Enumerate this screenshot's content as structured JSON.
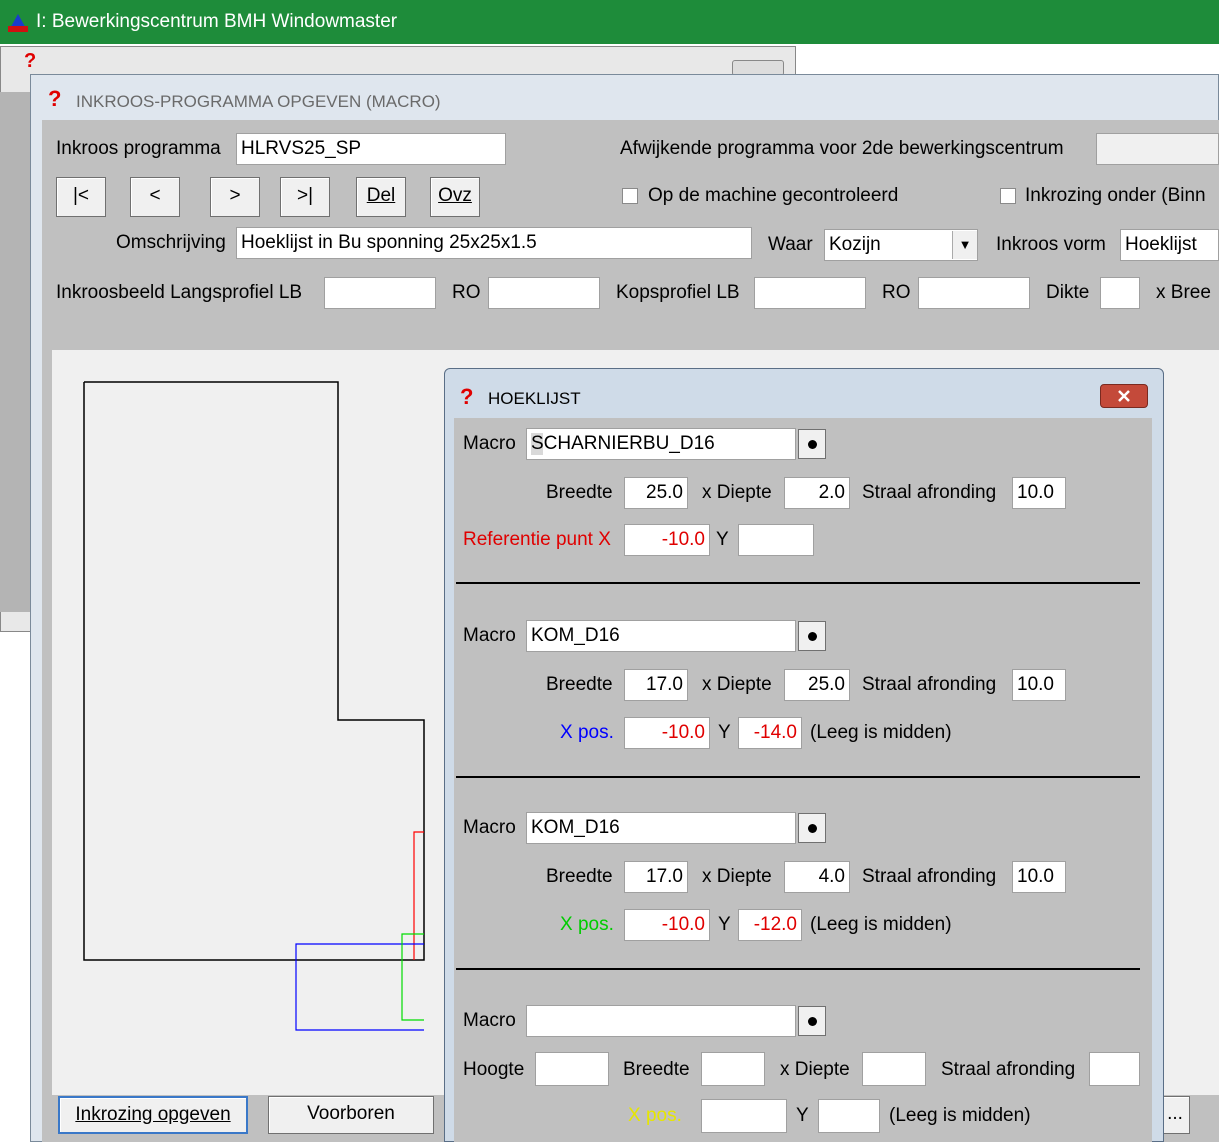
{
  "app": {
    "title": "I: Bewerkingscentrum BMH Windowmaster"
  },
  "main": {
    "title": "INKROOS-PROGRAMMA OPGEVEN (MACRO)",
    "inkroos_programma_label": "Inkroos programma",
    "inkroos_programma_value": "HLRVS25_SP",
    "afwijkend_label": "Afwijkende programma voor 2de bewerkingscentrum",
    "afwijkend_value": "",
    "nav": {
      "first": "|<",
      "prev": "<",
      "next": ">",
      "last": ">|",
      "del": "Del",
      "ovz": "Ovz"
    },
    "checkbox_gecontroleerd": "Op de machine gecontroleerd",
    "checkbox_onder": "Inkrozing onder (Binn",
    "omschrijving_label": "Omschrijving",
    "omschrijving_value": "Hoeklijst in Bu sponning 25x25x1.5",
    "waar_label": "Waar",
    "waar_value": "Kozijn",
    "vorm_label": "Inkroos vorm",
    "vorm_value": "Hoeklijst",
    "langs_label": "Inkroosbeeld Langsprofiel LB",
    "ro_label": "RO",
    "kops_label": "Kopsprofiel LB",
    "ro2_label": "RO",
    "dikte_label": "Dikte",
    "breedte_label": "x Bree",
    "btn_inkrozing": "Inkrozing opgeven",
    "btn_voorboren": "Voorboren",
    "btn_more": "..."
  },
  "dialog": {
    "title": "HOEKLIJST",
    "macro_label": "Macro",
    "sections": [
      {
        "macro": "SCHARNIERBU_D16",
        "breedte_label": "Breedte",
        "breedte": "25.0",
        "diepte_label": "x Diepte",
        "diepte": "2.0",
        "straal_label": "Straal afronding",
        "straal": "10.0",
        "pos_label": "Referentie punt X",
        "pos_x": "-10.0",
        "y_label": "Y",
        "pos_y": "",
        "note": ""
      },
      {
        "macro": "KOM_D16",
        "breedte_label": "Breedte",
        "breedte": "17.0",
        "diepte_label": "x Diepte",
        "diepte": "25.0",
        "straal_label": "Straal afronding",
        "straal": "10.0",
        "pos_label": "X pos.",
        "pos_x": "-10.0",
        "y_label": "Y",
        "pos_y": "-14.0",
        "note": "(Leeg is midden)"
      },
      {
        "macro": "KOM_D16",
        "breedte_label": "Breedte",
        "breedte": "17.0",
        "diepte_label": "x Diepte",
        "diepte": "4.0",
        "straal_label": "Straal afronding",
        "straal": "10.0",
        "pos_label": "X pos.",
        "pos_x": "-10.0",
        "y_label": "Y",
        "pos_y": "-12.0",
        "note": "(Leeg is midden)"
      },
      {
        "macro": "",
        "hoogte_label": "Hoogte",
        "hoogte": "",
        "breedte_label": "Breedte",
        "breedte": "",
        "diepte_label": "x Diepte",
        "diepte": "",
        "straal_label": "Straal afronding",
        "straal": "",
        "pos_label": "X pos.",
        "pos_x": "",
        "y_label": "Y",
        "pos_y": "",
        "note": "(Leeg is midden)"
      }
    ]
  },
  "colors": {
    "titlebar_green": "#1e8c3a",
    "label_red": "#e00000",
    "label_blue": "#0000ff",
    "label_green": "#00cc00",
    "label_yellow": "#e6e600"
  }
}
